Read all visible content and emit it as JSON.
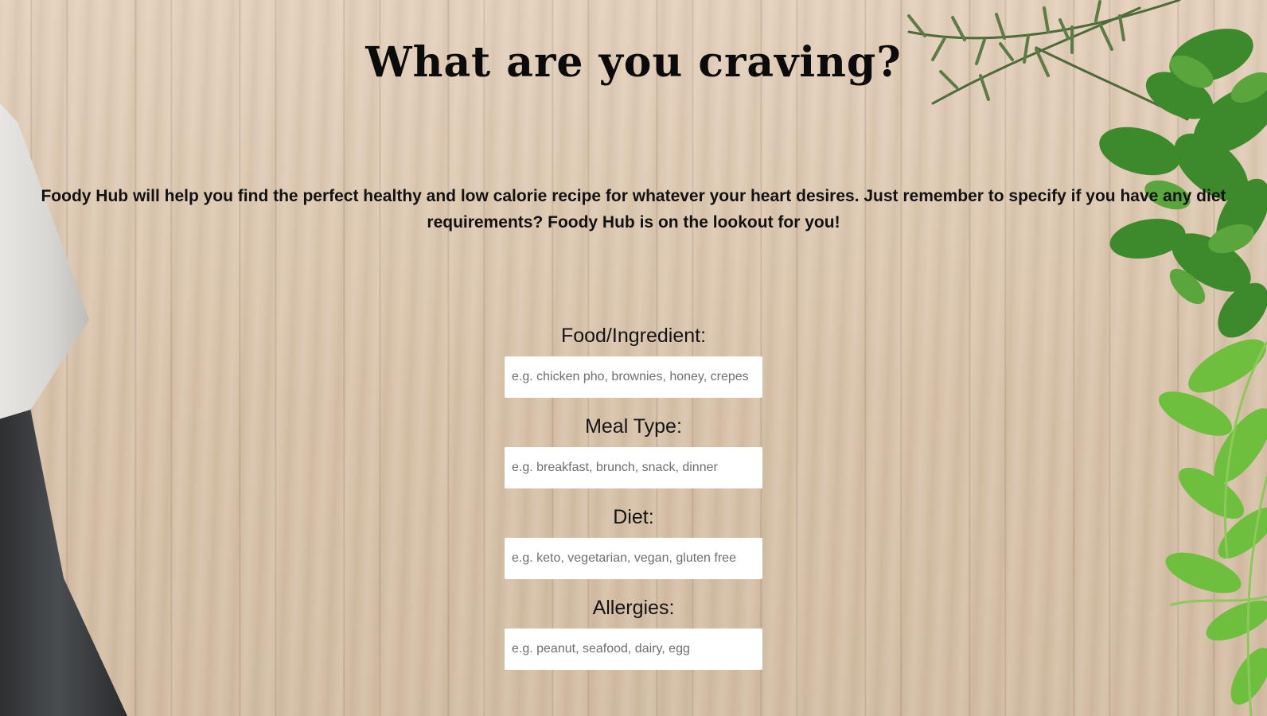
{
  "header": {
    "title": "What are you craving?"
  },
  "intro": {
    "text": "Foody Hub will help you find the perfect healthy and low calorie recipe for whatever your heart desires. Just remember to specify if you have any diet requirements? Foody Hub is on the lookout for you!"
  },
  "form": {
    "fields": [
      {
        "label": "Food/Ingredient:",
        "value": "",
        "placeholder": "e.g. chicken pho, brownies, honey, crepes"
      },
      {
        "label": "Meal Type:",
        "value": "",
        "placeholder": "e.g. breakfast, brunch, snack, dinner"
      },
      {
        "label": "Diet:",
        "value": "",
        "placeholder": "e.g. keto, vegetarian, vegan, gluten free"
      },
      {
        "label": "Allergies:",
        "value": "",
        "placeholder": "e.g. peanut, seafood, dairy, egg"
      }
    ]
  },
  "background": {
    "image": "wooden-cutting-board-with-knife-and-herbs",
    "colors": {
      "wood": "#dcc7b1",
      "herb_green": "#3f8a2a",
      "knife_handle": "#2d2f31"
    }
  }
}
